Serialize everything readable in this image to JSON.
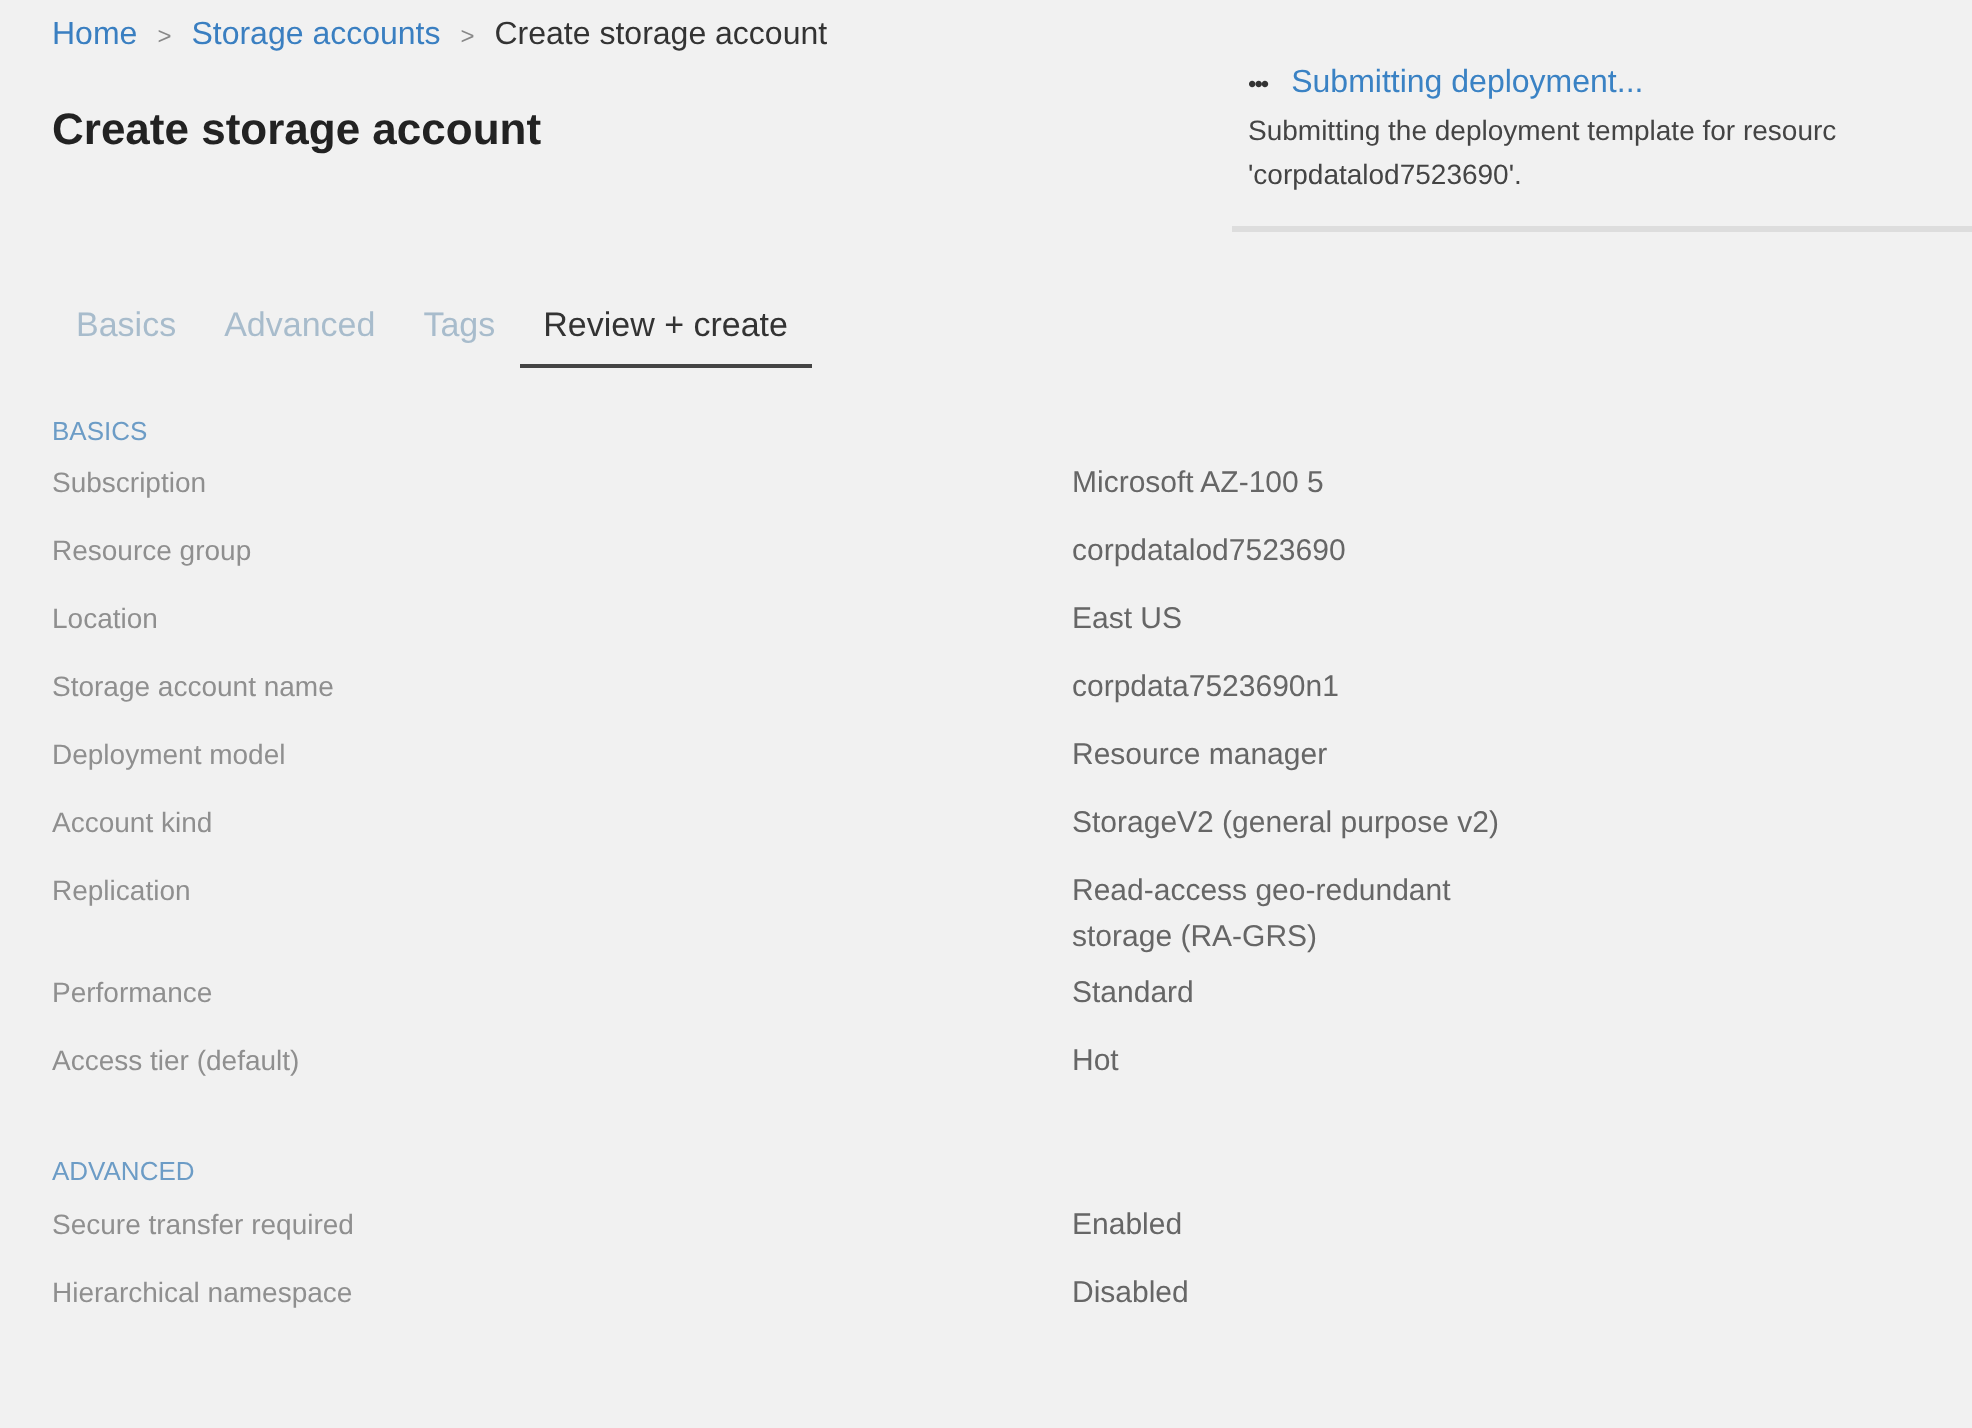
{
  "breadcrumb": [
    {
      "label": "Home",
      "kind": "link"
    },
    {
      "label": "Storage accounts",
      "kind": "link"
    },
    {
      "label": "Create storage account",
      "kind": "current"
    }
  ],
  "breadcrumb_separator": ">",
  "title": "Create storage account",
  "notification": {
    "icon": "•••",
    "title": "Submitting deployment...",
    "lines": [
      "Submitting the deployment template for resourc",
      "'corpdatalod7523690'."
    ]
  },
  "tabs": [
    {
      "label": "Basics",
      "selected": false
    },
    {
      "label": "Advanced",
      "selected": false
    },
    {
      "label": "Tags",
      "selected": false
    },
    {
      "label": "Review + create",
      "selected": true
    }
  ],
  "sections": [
    {
      "heading": "BASICS",
      "rows": [
        {
          "label": "Subscription",
          "value": "Microsoft AZ-100 5"
        },
        {
          "label": "Resource group",
          "value": "corpdatalod7523690"
        },
        {
          "label": "Location",
          "value": "East US"
        },
        {
          "label": "Storage account name",
          "value": "corpdata7523690n1"
        },
        {
          "label": "Deployment model",
          "value": "Resource manager"
        },
        {
          "label": "Account kind",
          "value": "StorageV2 (general purpose v2)"
        },
        {
          "label": "Replication",
          "value": "Read-access geo-redundant storage (RA-GRS)"
        },
        {
          "label": "Performance",
          "value": "Standard"
        },
        {
          "label": "Access tier (default)",
          "value": "Hot"
        }
      ]
    },
    {
      "heading": "ADVANCED",
      "rows": [
        {
          "label": "Secure transfer required",
          "value": "Enabled"
        },
        {
          "label": "Hierarchical namespace",
          "value": "Disabled"
        }
      ]
    }
  ]
}
